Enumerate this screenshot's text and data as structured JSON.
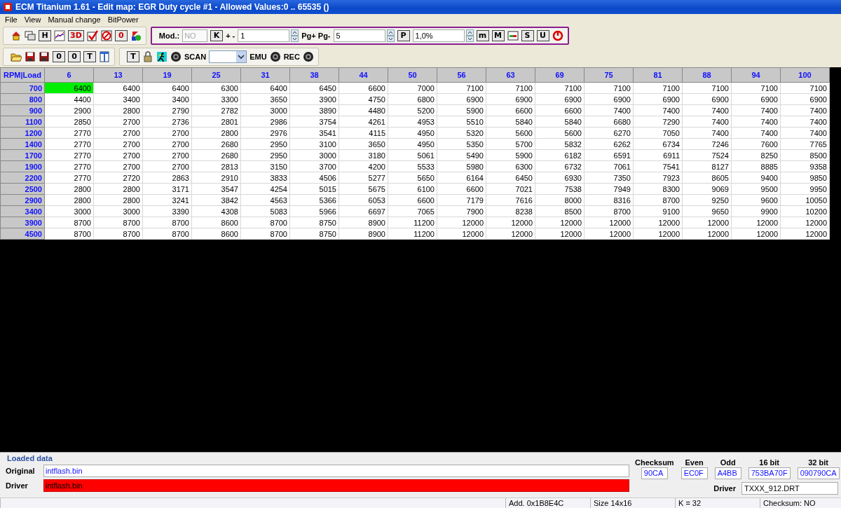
{
  "window": {
    "title": "ECM Titanium 1.61 - Edit map: EGR Duty cycle #1 - Allowed Values:0 .. 65535 ()"
  },
  "menu": [
    "File",
    "View",
    "Manual change",
    "BitPower"
  ],
  "toolbar_rows": [
    {
      "groups": [
        {
          "highlighted": false,
          "items": [
            {
              "kind": "icon"
            },
            {
              "kind": "icon"
            },
            {
              "kind": "letter",
              "label": "H",
              "color": "#000000"
            },
            {
              "kind": "icon"
            },
            {
              "kind": "letter",
              "label": "3D",
              "color": "#cc0000"
            },
            {
              "kind": "icon"
            },
            {
              "kind": "icon"
            },
            {
              "kind": "letter",
              "label": "0",
              "color": "#cc0000"
            },
            {
              "kind": "icon"
            }
          ]
        },
        {
          "highlighted": true,
          "items": [
            {
              "kind": "text",
              "label": "Mod.:"
            },
            {
              "kind": "field",
              "value": "NO",
              "disabled": true
            },
            {
              "kind": "letter",
              "label": "K",
              "color": "#000000"
            },
            {
              "kind": "text",
              "label": "+ -"
            },
            {
              "kind": "spin",
              "value": "1"
            },
            {
              "kind": "text",
              "label": "Pg+ Pg-"
            },
            {
              "kind": "spin",
              "value": "5"
            },
            {
              "kind": "letter",
              "label": "P",
              "color": "#000000"
            },
            {
              "kind": "spin",
              "value": "1,0%"
            },
            {
              "kind": "letter",
              "label": "m",
              "color": "#000000"
            },
            {
              "kind": "letter",
              "label": "M",
              "color": "#000000"
            },
            {
              "kind": "icon"
            },
            {
              "kind": "letter",
              "label": "S",
              "color": "#000000"
            },
            {
              "kind": "letter",
              "label": "U",
              "color": "#000000"
            },
            {
              "kind": "icon"
            }
          ]
        }
      ]
    },
    {
      "groups": [
        {
          "highlighted": false,
          "items": [
            {
              "kind": "icon"
            },
            {
              "kind": "icon"
            },
            {
              "kind": "icon"
            },
            {
              "kind": "letter",
              "label": "0",
              "color": "#000000"
            },
            {
              "kind": "letter",
              "label": "0",
              "color": "#000000"
            },
            {
              "kind": "letter",
              "label": "T",
              "color": "#000000"
            },
            {
              "kind": "icon"
            }
          ]
        },
        {
          "highlighted": false,
          "items": [
            {
              "kind": "letter",
              "label": "T",
              "color": "#000000"
            },
            {
              "kind": "icon"
            },
            {
              "kind": "icon"
            },
            {
              "kind": "icon"
            },
            {
              "kind": "text",
              "label": "SCAN"
            },
            {
              "kind": "combo"
            },
            {
              "kind": "text",
              "label": "EMU"
            },
            {
              "kind": "icon"
            },
            {
              "kind": "text",
              "label": "REC"
            },
            {
              "kind": "icon"
            }
          ]
        }
      ]
    }
  ],
  "table": {
    "corner": "RPM|Load",
    "columns": [
      "6",
      "13",
      "19",
      "25",
      "31",
      "38",
      "44",
      "50",
      "56",
      "63",
      "69",
      "75",
      "81",
      "88",
      "94",
      "100"
    ],
    "rows": [
      {
        "rpm": "700",
        "cells": [
          {
            "text": "6400",
            "selected": true
          },
          {
            "text": "6400",
            "selected": false
          },
          {
            "text": "6400",
            "selected": false
          },
          {
            "text": "6300",
            "selected": false
          },
          {
            "text": "6400",
            "selected": false
          },
          {
            "text": "6450",
            "selected": false
          },
          {
            "text": "6600",
            "selected": false
          },
          {
            "text": "7000",
            "selected": false
          },
          {
            "text": "7100",
            "selected": false
          },
          {
            "text": "7100",
            "selected": false
          },
          {
            "text": "7100",
            "selected": false
          },
          {
            "text": "7100",
            "selected": false
          },
          {
            "text": "7100",
            "selected": false
          },
          {
            "text": "7100",
            "selected": false
          },
          {
            "text": "7100",
            "selected": false
          },
          {
            "text": "7100",
            "selected": false
          }
        ]
      },
      {
        "rpm": "800",
        "cells": [
          {
            "text": "4400",
            "selected": false
          },
          {
            "text": "3400",
            "selected": false
          },
          {
            "text": "3400",
            "selected": false
          },
          {
            "text": "3300",
            "selected": false
          },
          {
            "text": "3650",
            "selected": false
          },
          {
            "text": "3900",
            "selected": false
          },
          {
            "text": "4750",
            "selected": false
          },
          {
            "text": "6800",
            "selected": false
          },
          {
            "text": "6900",
            "selected": false
          },
          {
            "text": "6900",
            "selected": false
          },
          {
            "text": "6900",
            "selected": false
          },
          {
            "text": "6900",
            "selected": false
          },
          {
            "text": "6900",
            "selected": false
          },
          {
            "text": "6900",
            "selected": false
          },
          {
            "text": "6900",
            "selected": false
          },
          {
            "text": "6900",
            "selected": false
          }
        ]
      },
      {
        "rpm": "900",
        "cells": [
          {
            "text": "2900",
            "selected": false
          },
          {
            "text": "2800",
            "selected": false
          },
          {
            "text": "2790",
            "selected": false
          },
          {
            "text": "2782",
            "selected": false
          },
          {
            "text": "3000",
            "selected": false
          },
          {
            "text": "3890",
            "selected": false
          },
          {
            "text": "4480",
            "selected": false
          },
          {
            "text": "5200",
            "selected": false
          },
          {
            "text": "5900",
            "selected": false
          },
          {
            "text": "6600",
            "selected": false
          },
          {
            "text": "6600",
            "selected": false
          },
          {
            "text": "7400",
            "selected": false
          },
          {
            "text": "7400",
            "selected": false
          },
          {
            "text": "7400",
            "selected": false
          },
          {
            "text": "7400",
            "selected": false
          },
          {
            "text": "7400",
            "selected": false
          }
        ]
      },
      {
        "rpm": "1100",
        "cells": [
          {
            "text": "2850",
            "selected": false
          },
          {
            "text": "2700",
            "selected": false
          },
          {
            "text": "2736",
            "selected": false
          },
          {
            "text": "2801",
            "selected": false
          },
          {
            "text": "2986",
            "selected": false
          },
          {
            "text": "3754",
            "selected": false
          },
          {
            "text": "4261",
            "selected": false
          },
          {
            "text": "4953",
            "selected": false
          },
          {
            "text": "5510",
            "selected": false
          },
          {
            "text": "5840",
            "selected": false
          },
          {
            "text": "5840",
            "selected": false
          },
          {
            "text": "6680",
            "selected": false
          },
          {
            "text": "7290",
            "selected": false
          },
          {
            "text": "7400",
            "selected": false
          },
          {
            "text": "7400",
            "selected": false
          },
          {
            "text": "7400",
            "selected": false
          }
        ]
      },
      {
        "rpm": "1200",
        "cells": [
          {
            "text": "2770",
            "selected": false
          },
          {
            "text": "2700",
            "selected": false
          },
          {
            "text": "2700",
            "selected": false
          },
          {
            "text": "2800",
            "selected": false
          },
          {
            "text": "2976",
            "selected": false
          },
          {
            "text": "3541",
            "selected": false
          },
          {
            "text": "4115",
            "selected": false
          },
          {
            "text": "4950",
            "selected": false
          },
          {
            "text": "5320",
            "selected": false
          },
          {
            "text": "5600",
            "selected": false
          },
          {
            "text": "5600",
            "selected": false
          },
          {
            "text": "6270",
            "selected": false
          },
          {
            "text": "7050",
            "selected": false
          },
          {
            "text": "7400",
            "selected": false
          },
          {
            "text": "7400",
            "selected": false
          },
          {
            "text": "7400",
            "selected": false
          }
        ]
      },
      {
        "rpm": "1400",
        "cells": [
          {
            "text": "2770",
            "selected": false
          },
          {
            "text": "2700",
            "selected": false
          },
          {
            "text": "2700",
            "selected": false
          },
          {
            "text": "2680",
            "selected": false
          },
          {
            "text": "2950",
            "selected": false
          },
          {
            "text": "3100",
            "selected": false
          },
          {
            "text": "3650",
            "selected": false
          },
          {
            "text": "4950",
            "selected": false
          },
          {
            "text": "5350",
            "selected": false
          },
          {
            "text": "5700",
            "selected": false
          },
          {
            "text": "5832",
            "selected": false
          },
          {
            "text": "6262",
            "selected": false
          },
          {
            "text": "6734",
            "selected": false
          },
          {
            "text": "7246",
            "selected": false
          },
          {
            "text": "7600",
            "selected": false
          },
          {
            "text": "7765",
            "selected": false
          }
        ]
      },
      {
        "rpm": "1700",
        "cells": [
          {
            "text": "2770",
            "selected": false
          },
          {
            "text": "2700",
            "selected": false
          },
          {
            "text": "2700",
            "selected": false
          },
          {
            "text": "2680",
            "selected": false
          },
          {
            "text": "2950",
            "selected": false
          },
          {
            "text": "3000",
            "selected": false
          },
          {
            "text": "3180",
            "selected": false
          },
          {
            "text": "5061",
            "selected": false
          },
          {
            "text": "5490",
            "selected": false
          },
          {
            "text": "5900",
            "selected": false
          },
          {
            "text": "6182",
            "selected": false
          },
          {
            "text": "6591",
            "selected": false
          },
          {
            "text": "6911",
            "selected": false
          },
          {
            "text": "7524",
            "selected": false
          },
          {
            "text": "8250",
            "selected": false
          },
          {
            "text": "8500",
            "selected": false
          }
        ]
      },
      {
        "rpm": "1900",
        "cells": [
          {
            "text": "2770",
            "selected": false
          },
          {
            "text": "2700",
            "selected": false
          },
          {
            "text": "2700",
            "selected": false
          },
          {
            "text": "2813",
            "selected": false
          },
          {
            "text": "3150",
            "selected": false
          },
          {
            "text": "3700",
            "selected": false
          },
          {
            "text": "4200",
            "selected": false
          },
          {
            "text": "5533",
            "selected": false
          },
          {
            "text": "5980",
            "selected": false
          },
          {
            "text": "6300",
            "selected": false
          },
          {
            "text": "6732",
            "selected": false
          },
          {
            "text": "7061",
            "selected": false
          },
          {
            "text": "7541",
            "selected": false
          },
          {
            "text": "8127",
            "selected": false
          },
          {
            "text": "8885",
            "selected": false
          },
          {
            "text": "9358",
            "selected": false
          }
        ]
      },
      {
        "rpm": "2200",
        "cells": [
          {
            "text": "2770",
            "selected": false
          },
          {
            "text": "2720",
            "selected": false
          },
          {
            "text": "2863",
            "selected": false
          },
          {
            "text": "2910",
            "selected": false
          },
          {
            "text": "3833",
            "selected": false
          },
          {
            "text": "4506",
            "selected": false
          },
          {
            "text": "5277",
            "selected": false
          },
          {
            "text": "5650",
            "selected": false
          },
          {
            "text": "6164",
            "selected": false
          },
          {
            "text": "6450",
            "selected": false
          },
          {
            "text": "6930",
            "selected": false
          },
          {
            "text": "7350",
            "selected": false
          },
          {
            "text": "7923",
            "selected": false
          },
          {
            "text": "8605",
            "selected": false
          },
          {
            "text": "9400",
            "selected": false
          },
          {
            "text": "9850",
            "selected": false
          }
        ]
      },
      {
        "rpm": "2500",
        "cells": [
          {
            "text": "2800",
            "selected": false
          },
          {
            "text": "2800",
            "selected": false
          },
          {
            "text": "3171",
            "selected": false
          },
          {
            "text": "3547",
            "selected": false
          },
          {
            "text": "4254",
            "selected": false
          },
          {
            "text": "5015",
            "selected": false
          },
          {
            "text": "5675",
            "selected": false
          },
          {
            "text": "6100",
            "selected": false
          },
          {
            "text": "6600",
            "selected": false
          },
          {
            "text": "7021",
            "selected": false
          },
          {
            "text": "7538",
            "selected": false
          },
          {
            "text": "7949",
            "selected": false
          },
          {
            "text": "8300",
            "selected": false
          },
          {
            "text": "9069",
            "selected": false
          },
          {
            "text": "9500",
            "selected": false
          },
          {
            "text": "9950",
            "selected": false
          }
        ]
      },
      {
        "rpm": "2900",
        "cells": [
          {
            "text": "2800",
            "selected": false
          },
          {
            "text": "2800",
            "selected": false
          },
          {
            "text": "3241",
            "selected": false
          },
          {
            "text": "3842",
            "selected": false
          },
          {
            "text": "4563",
            "selected": false
          },
          {
            "text": "5366",
            "selected": false
          },
          {
            "text": "6053",
            "selected": false
          },
          {
            "text": "6600",
            "selected": false
          },
          {
            "text": "7179",
            "selected": false
          },
          {
            "text": "7616",
            "selected": false
          },
          {
            "text": "8000",
            "selected": false
          },
          {
            "text": "8316",
            "selected": false
          },
          {
            "text": "8700",
            "selected": false
          },
          {
            "text": "9250",
            "selected": false
          },
          {
            "text": "9600",
            "selected": false
          },
          {
            "text": "10050",
            "selected": false
          }
        ]
      },
      {
        "rpm": "3400",
        "cells": [
          {
            "text": "3000",
            "selected": false
          },
          {
            "text": "3000",
            "selected": false
          },
          {
            "text": "3390",
            "selected": false
          },
          {
            "text": "4308",
            "selected": false
          },
          {
            "text": "5083",
            "selected": false
          },
          {
            "text": "5966",
            "selected": false
          },
          {
            "text": "6697",
            "selected": false
          },
          {
            "text": "7065",
            "selected": false
          },
          {
            "text": "7900",
            "selected": false
          },
          {
            "text": "8238",
            "selected": false
          },
          {
            "text": "8500",
            "selected": false
          },
          {
            "text": "8700",
            "selected": false
          },
          {
            "text": "9100",
            "selected": false
          },
          {
            "text": "9650",
            "selected": false
          },
          {
            "text": "9900",
            "selected": false
          },
          {
            "text": "10200",
            "selected": false
          }
        ]
      },
      {
        "rpm": "3900",
        "cells": [
          {
            "text": "8700",
            "selected": false
          },
          {
            "text": "8700",
            "selected": false
          },
          {
            "text": "8700",
            "selected": false
          },
          {
            "text": "8600",
            "selected": false
          },
          {
            "text": "8700",
            "selected": false
          },
          {
            "text": "8750",
            "selected": false
          },
          {
            "text": "8900",
            "selected": false
          },
          {
            "text": "11200",
            "selected": false
          },
          {
            "text": "12000",
            "selected": false
          },
          {
            "text": "12000",
            "selected": false
          },
          {
            "text": "12000",
            "selected": false
          },
          {
            "text": "12000",
            "selected": false
          },
          {
            "text": "12000",
            "selected": false
          },
          {
            "text": "12000",
            "selected": false
          },
          {
            "text": "12000",
            "selected": false
          },
          {
            "text": "12000",
            "selected": false
          }
        ]
      },
      {
        "rpm": "4500",
        "cells": [
          {
            "text": "8700",
            "selected": false
          },
          {
            "text": "8700",
            "selected": false
          },
          {
            "text": "8700",
            "selected": false
          },
          {
            "text": "8600",
            "selected": false
          },
          {
            "text": "8700",
            "selected": false
          },
          {
            "text": "8750",
            "selected": false
          },
          {
            "text": "8900",
            "selected": false
          },
          {
            "text": "11200",
            "selected": false
          },
          {
            "text": "12000",
            "selected": false
          },
          {
            "text": "12000",
            "selected": false
          },
          {
            "text": "12000",
            "selected": false
          },
          {
            "text": "12000",
            "selected": false
          },
          {
            "text": "12000",
            "selected": false
          },
          {
            "text": "12000",
            "selected": false
          },
          {
            "text": "12000",
            "selected": false
          },
          {
            "text": "12000",
            "selected": false
          }
        ]
      }
    ]
  },
  "loaded_data": {
    "title": "Loaded data",
    "fields": [
      {
        "label": "Original",
        "value": "intflash.bin",
        "error": false
      },
      {
        "label": "Driver",
        "value": "intflash.bin",
        "error": true
      }
    ],
    "checksums": [
      {
        "label": "Checksum",
        "value": "90CA"
      },
      {
        "label": "Even",
        "value": "EC0F"
      },
      {
        "label": "Odd",
        "value": "A4BB"
      },
      {
        "label": "16 bit",
        "value": "753BA70F"
      },
      {
        "label": "32 bit",
        "value": "090790CA"
      }
    ],
    "driver": {
      "label": "Driver",
      "value": "TXXX_912.DRT"
    }
  },
  "status_bar": [
    "Add. 0x1B8E4C",
    "Size 14x16",
    "K = 32",
    "Checksum: NO"
  ]
}
